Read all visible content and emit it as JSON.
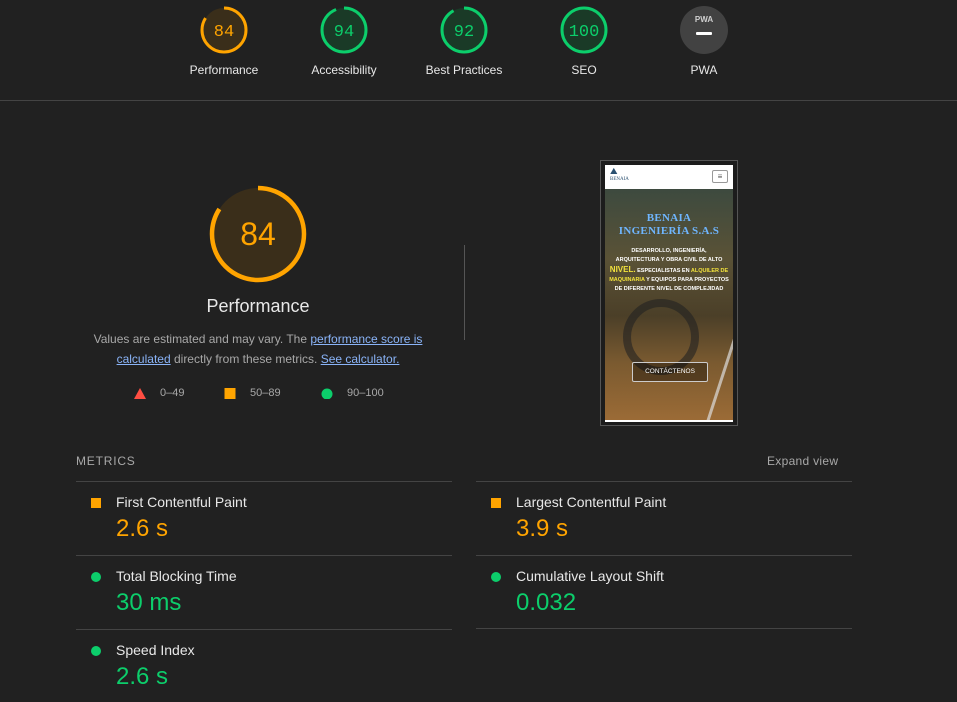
{
  "colors": {
    "fail": "#ff4e42",
    "average": "#ffa400",
    "pass": "#0cce6b",
    "neutral": "#9e9e9e"
  },
  "gauges": [
    {
      "score": "84",
      "label": "Performance",
      "status": "average"
    },
    {
      "score": "94",
      "label": "Accessibility",
      "status": "pass"
    },
    {
      "score": "92",
      "label": "Best Practices",
      "status": "pass"
    },
    {
      "score": "100",
      "label": "SEO",
      "status": "pass"
    },
    {
      "score": "—",
      "label": "PWA",
      "badge": "PWA",
      "status": "neutral"
    }
  ],
  "main": {
    "score": "84",
    "title": "Performance",
    "note_prefix": "Values are estimated and may vary. The ",
    "note_link1": "performance score is calculated",
    "note_middle": " directly from these metrics. ",
    "note_link2": "See calculator."
  },
  "legend": [
    {
      "icon": "triangle-icon",
      "range": "0–49"
    },
    {
      "icon": "square-icon",
      "range": "50–89"
    },
    {
      "icon": "circle-icon",
      "range": "90–100"
    }
  ],
  "screenshot": {
    "logo": "BENAIA",
    "heading_line1": "BENAIA",
    "heading_line2": "INGENIERÍA S.A.S",
    "text_a": "DESARROLLO, INGENIERÍA, ARQUITECTURA Y OBRA CIVIL DE ALTO ",
    "text_nivel": "NIVEL.",
    "text_b": " ESPECIALISTAS EN ",
    "text_alquiler": "ALQUILER DE MAQUINARIA",
    "text_c": " Y EQUIPOS PARA PROYECTOS DE DIFERENTE NIVEL DE COMPLEJIDAD",
    "button": "CONTÁCTENOS"
  },
  "metrics_section": {
    "title": "METRICS",
    "expand": "Expand view"
  },
  "metrics": [
    {
      "name": "First Contentful Paint",
      "value": "2.6 s",
      "status": "average"
    },
    {
      "name": "Largest Contentful Paint",
      "value": "3.9 s",
      "status": "average"
    },
    {
      "name": "Total Blocking Time",
      "value": "30 ms",
      "status": "pass"
    },
    {
      "name": "Cumulative Layout Shift",
      "value": "0.032",
      "status": "pass"
    },
    {
      "name": "Speed Index",
      "value": "2.6 s",
      "status": "pass"
    }
  ]
}
